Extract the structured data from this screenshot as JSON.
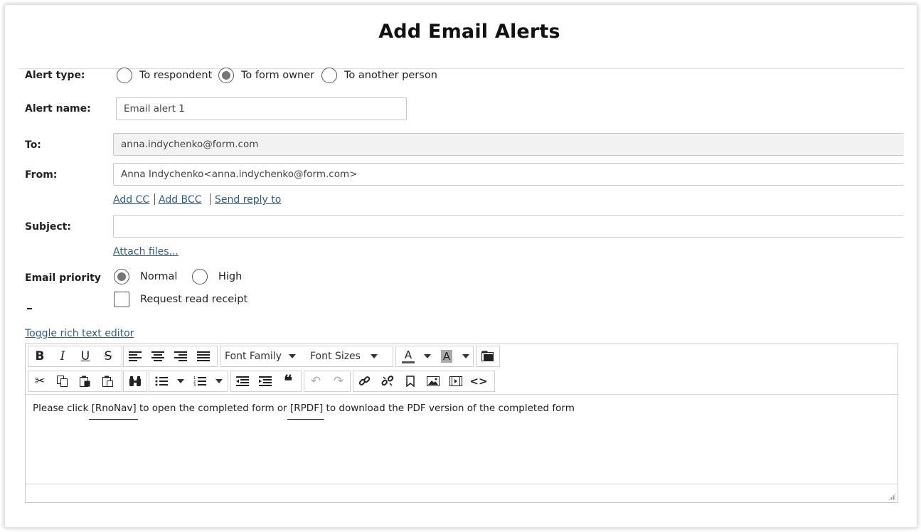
{
  "dialog": {
    "title": "Add Email Alerts"
  },
  "alert_type": {
    "label": "Alert type:",
    "options": [
      "To respondent",
      "To form owner",
      "To another person"
    ],
    "selected": "To form owner"
  },
  "alert_name": {
    "label": "Alert name:",
    "value": "Email alert 1"
  },
  "to": {
    "label": "To:",
    "value": "anna.indychenko@form.com"
  },
  "from": {
    "label": "From:",
    "value": "Anna Indychenko<anna.indychenko@form.com>"
  },
  "links": {
    "add_cc": "Add CC",
    "add_bcc": "Add BCC",
    "send_reply_to": "Send reply to",
    "attach_files": "Attach files..."
  },
  "subject": {
    "label": "Subject:",
    "value": ""
  },
  "priority": {
    "label": "Email priority",
    "options": [
      "Normal",
      "High"
    ],
    "selected": "Normal"
  },
  "read_receipt": {
    "label": "Request read receipt",
    "checked": false
  },
  "toggle_rich_text": "Toggle rich text editor",
  "editor": {
    "font_family": "Font Family",
    "font_sizes": "Font Sizes",
    "body_parts": [
      "Please click ",
      "[RnoNav]",
      " to open the completed form or ",
      "[RPDF]",
      " to download the PDF version of the completed form"
    ]
  }
}
